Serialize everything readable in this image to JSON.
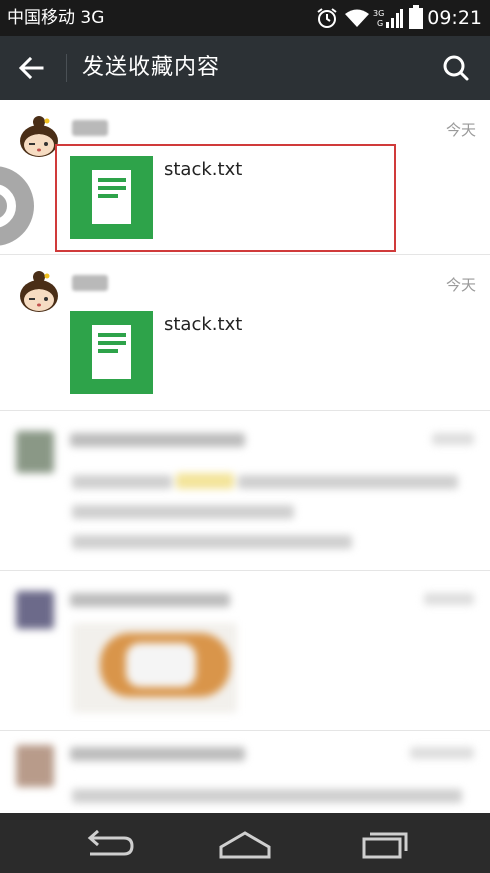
{
  "status_bar": {
    "carrier": "中国移动 3G",
    "network": "3G",
    "time": "09:21"
  },
  "header": {
    "title": "发送收藏内容",
    "back_icon": "arrow-left-icon",
    "search_icon": "search-icon"
  },
  "items": [
    {
      "time": "今天",
      "file_name": "stack.txt",
      "file_icon": "document-icon",
      "selected": true
    },
    {
      "time": "今天",
      "file_name": "stack.txt",
      "file_icon": "document-icon",
      "selected": false
    }
  ],
  "colors": {
    "status_bar": "#1a1a1a",
    "title_bar": "#2c3135",
    "file_icon": "#2ea34a",
    "highlight": "#d03a3a",
    "nav_bar": "#2b2b2b"
  },
  "nav": {
    "back_icon": "nav-back-icon",
    "home_icon": "nav-home-icon",
    "recents_icon": "nav-recents-icon"
  }
}
